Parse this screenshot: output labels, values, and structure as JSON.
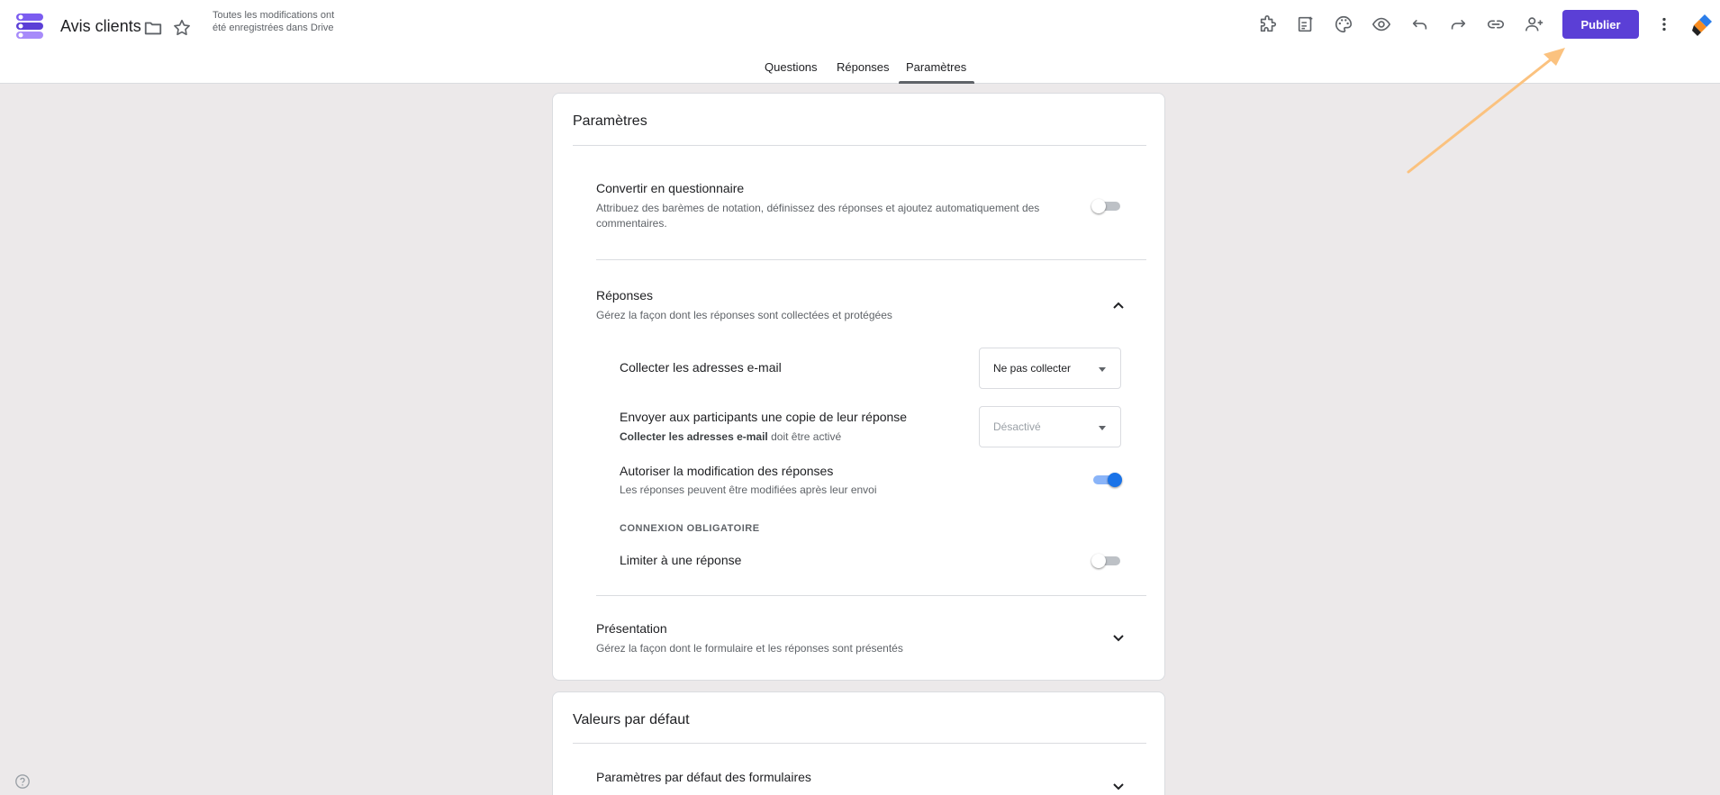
{
  "app": {
    "title": "Avis clients",
    "save_status": "Toutes les modifications ont été enregistrées dans Drive",
    "publish_label": "Publier",
    "accent_color": "#5b3fd6"
  },
  "tabs": [
    {
      "label": "Questions"
    },
    {
      "label": "Réponses"
    },
    {
      "label": "Paramètres",
      "active": true
    }
  ],
  "settings_card": {
    "title": "Paramètres",
    "quiz": {
      "title": "Convertir en questionnaire",
      "description": "Attribuez des barèmes de notation, définissez des réponses et ajoutez automatiquement des commentaires.",
      "enabled": false
    },
    "responses": {
      "title": "Réponses",
      "description": "Gérez la façon dont les réponses sont collectées et protégées",
      "collect_email": {
        "label": "Collecter les adresses e-mail",
        "selected": "Ne pas collecter"
      },
      "send_copy": {
        "label": "Envoyer aux participants une copie de leur réponse",
        "note_bold": "Collecter les adresses e-mail",
        "note_rest": " doit être activé",
        "selected": "Désactivé"
      },
      "allow_edit": {
        "label": "Autoriser la modification des réponses",
        "description": "Les réponses peuvent être modifiées après leur envoi",
        "enabled": true
      },
      "login_heading": "CONNEXION OBLIGATOIRE",
      "limit_one": {
        "label": "Limiter à une réponse",
        "enabled": false
      }
    },
    "presentation": {
      "title": "Présentation",
      "description": "Gérez la façon dont le formulaire et les réponses sont présentés"
    }
  },
  "defaults_card": {
    "title": "Valeurs par défaut",
    "form_defaults": {
      "title": "Paramètres par défaut des formulaires"
    }
  },
  "icons": [
    "forms-logo",
    "folder-icon",
    "star-icon",
    "addon-icon",
    "customize-icon",
    "palette-icon",
    "preview-icon",
    "undo-icon",
    "redo-icon",
    "link-icon",
    "add-collaborator-icon",
    "more-vert-icon",
    "app-logo",
    "help-icon"
  ]
}
